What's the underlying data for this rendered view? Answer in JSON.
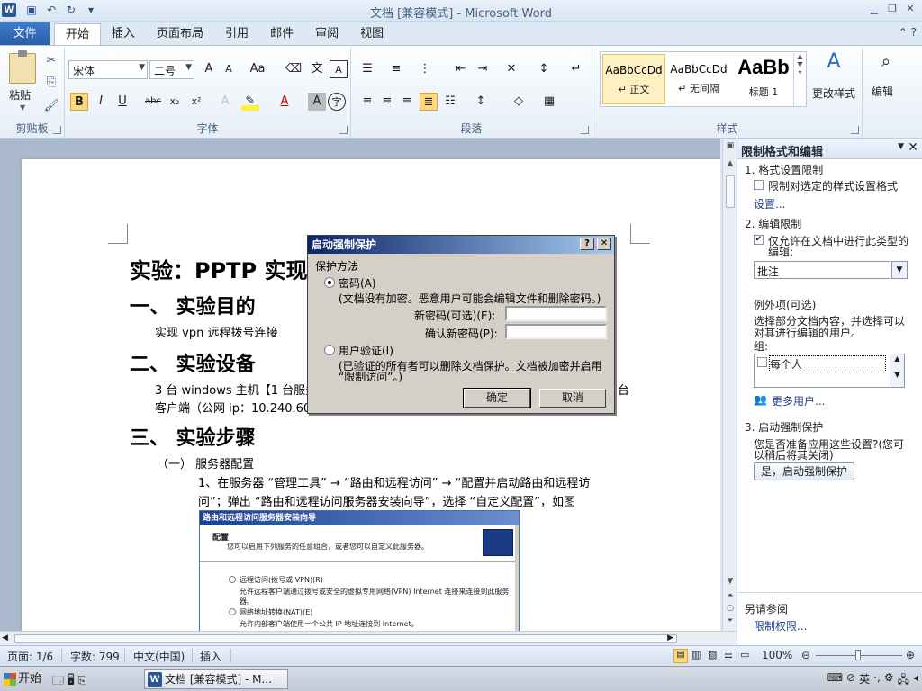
{
  "window": {
    "title": "文档 [兼容模式] - Microsoft Word",
    "app_icon": "W"
  },
  "ribbon": {
    "file_tab": "文件",
    "tabs": [
      "开始",
      "插入",
      "页面布局",
      "引用",
      "邮件",
      "审阅",
      "视图"
    ],
    "clipboard": {
      "paste": "粘贴",
      "group_label": "剪贴板"
    },
    "font": {
      "name": "宋体",
      "size": "二号",
      "group_label": "字体"
    },
    "paragraph": {
      "group_label": "段落"
    },
    "styles": {
      "group_label": "样式",
      "items": [
        {
          "preview": "AaBbCcDd",
          "name": "↵ 正文"
        },
        {
          "preview": "AaBbCcDd",
          "name": "↵ 无间隔"
        },
        {
          "preview": "AaBb",
          "name": "标题 1"
        }
      ],
      "change_styles": "更改样式"
    },
    "editing": {
      "label": "编辑"
    }
  },
  "document": {
    "title": "实验：PPTP 实现",
    "h_purpose": "一、  实验目的",
    "p_purpose": "实现 vpn 远程拨号连接",
    "h_devices": "二、  实验设备",
    "p_devices_1a": "3 台 windows 主机【1 台服务",
    "p_devices_1b": "台",
    "p_devices_2": "客户端（公网 ip：10.240.60",
    "h_steps": "三、  实验步骤",
    "p_step_sub": "（一）  服务器配置",
    "p_step_1": "1、在服务器 “管理工具” → “路由和远程访问” → “配置并启动路由和远程访",
    "p_step_2": "问”；弹出 “路由和远程访问服务器安装向导”，选择 “自定义配置”，如图",
    "wizard": {
      "title": "路由和远程访问服务器安装向导",
      "heading": "配置",
      "subtitle": "您可以启用下列服务的任意组合，或者您可以自定义此服务器。",
      "opt1": "远程访问(拨号或 VPN)(R)",
      "opt1_desc": "允许远程客户端通过拨号或安全的虚拟专用网络(VPN) Internet 连接来连接到此服务器。",
      "opt2": "网络地址转换(NAT)(E)",
      "opt2_desc": "允许内部客户端使用一个公共 IP 地址连接到 Internet。"
    }
  },
  "dialog": {
    "title": "启动强制保护",
    "help_btn": "?",
    "close_btn": "✕",
    "section": "保护方法",
    "opt_password": "密码(A)",
    "opt_password_desc": "(文档没有加密。恶意用户可能会编辑文件和删除密码。)",
    "new_password_label": "新密码(可选)(E):",
    "confirm_password_label": "确认新密码(P):",
    "new_password_value": "",
    "confirm_password_value": "",
    "opt_user_auth": "用户验证(I)",
    "opt_user_auth_desc_1": "(已验证的所有者可以删除文档保护。文档被加密并启用",
    "opt_user_auth_desc_2": "“限制访问”。)",
    "ok": "确定",
    "cancel": "取消"
  },
  "pane": {
    "title": "限制格式和编辑",
    "s1_title": "1. 格式设置限制",
    "s1_checkbox": "限制对选定的样式设置格式",
    "s1_link": "设置...",
    "s2_title": "2. 编辑限制",
    "s2_checkbox_1": "仅允许在文档中进行此类型的",
    "s2_checkbox_2": "编辑:",
    "s2_combo": "批注",
    "exceptions_title": "例外项(可选)",
    "exceptions_desc_1": "选择部分文档内容，并选择可以",
    "exceptions_desc_2": "对其进行编辑的用户。",
    "groups_label": "组:",
    "group_item": "每个人",
    "more_users": "更多用户...",
    "s3_title": "3. 启动强制保护",
    "s3_desc_1": "您是否准备应用这些设置?(您可",
    "s3_desc_2": "以稍后将其关闭)",
    "s3_button": "是，启动强制保护",
    "see_also": "另请参阅",
    "permissions_link": "限制权限..."
  },
  "status": {
    "page": "页面: 1/6",
    "words": "字数: 799",
    "lang": "中文(中国)",
    "mode": "插入",
    "zoom": "100%"
  },
  "taskbar": {
    "start": "开始",
    "task": "文档 [兼容模式] - M...",
    "ime": "英"
  }
}
